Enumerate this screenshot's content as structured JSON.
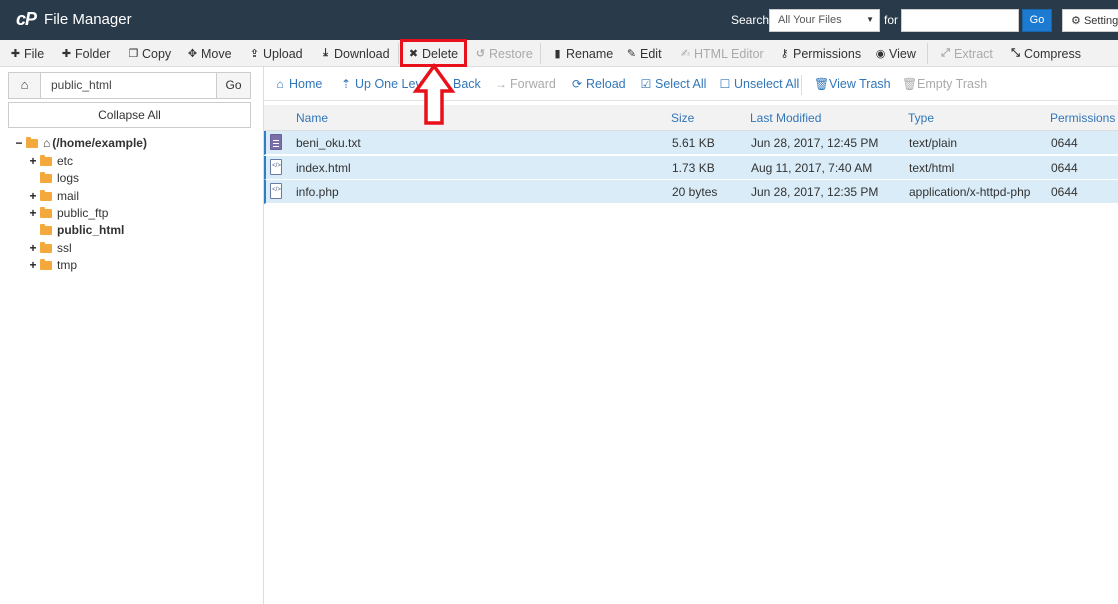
{
  "header": {
    "logo": "cP",
    "title": "File Manager",
    "search_label": "Search",
    "search_scope": "All Your Files",
    "for_label": "for",
    "search_value": "",
    "go_label": "Go",
    "settings_label": "Settings"
  },
  "toolbar": {
    "items": [
      {
        "label": "File",
        "icon": "plus-icon",
        "enabled": true
      },
      {
        "label": "Folder",
        "icon": "plus-icon",
        "enabled": true
      },
      {
        "label": "Copy",
        "icon": "copy-icon",
        "enabled": true
      },
      {
        "label": "Move",
        "icon": "move-icon",
        "enabled": true
      },
      {
        "label": "Upload",
        "icon": "upload-icon",
        "enabled": true
      },
      {
        "label": "Download",
        "icon": "download-icon",
        "enabled": true
      },
      {
        "label": "Delete",
        "icon": "x-icon",
        "enabled": true
      },
      {
        "label": "Restore",
        "icon": "undo-icon",
        "enabled": false
      },
      {
        "label": "Rename",
        "icon": "file-icon",
        "enabled": true
      },
      {
        "label": "Edit",
        "icon": "pencil-icon",
        "enabled": true
      },
      {
        "label": "HTML Editor",
        "icon": "edit-icon",
        "enabled": false
      },
      {
        "label": "Permissions",
        "icon": "key-icon",
        "enabled": true
      },
      {
        "label": "View",
        "icon": "eye-icon",
        "enabled": true
      },
      {
        "label": "Extract",
        "icon": "expand-icon",
        "enabled": false
      },
      {
        "label": "Compress",
        "icon": "compress-icon",
        "enabled": true
      }
    ],
    "highlight_color": "#e8101a"
  },
  "sidebar": {
    "path_value": "public_html",
    "go_label": "Go",
    "collapse_label": "Collapse All",
    "tree": [
      {
        "label": "(/home/example)",
        "toggle": "−",
        "level": 0,
        "bold": true,
        "icon": "home-icon"
      },
      {
        "label": "etc",
        "toggle": "+",
        "level": 1,
        "bold": false
      },
      {
        "label": "logs",
        "toggle": "",
        "level": 1,
        "bold": false
      },
      {
        "label": "mail",
        "toggle": "+",
        "level": 1,
        "bold": false
      },
      {
        "label": "public_ftp",
        "toggle": "+",
        "level": 1,
        "bold": false
      },
      {
        "label": "public_html",
        "toggle": "",
        "level": 1,
        "bold": true
      },
      {
        "label": "ssl",
        "toggle": "+",
        "level": 1,
        "bold": false
      },
      {
        "label": "tmp",
        "toggle": "+",
        "level": 1,
        "bold": false
      }
    ]
  },
  "navbar": {
    "items": [
      {
        "label": "Home",
        "icon": "home-icon",
        "enabled": true
      },
      {
        "label": "Up One Level",
        "icon": "level-up-icon",
        "enabled": true
      },
      {
        "label": "Back",
        "icon": "arrow-left-icon",
        "enabled": true
      },
      {
        "label": "Forward",
        "icon": "arrow-right-icon",
        "enabled": false
      },
      {
        "label": "Reload",
        "icon": "reload-icon",
        "enabled": true
      },
      {
        "label": "Select All",
        "icon": "checkbox-checked-icon",
        "enabled": true
      },
      {
        "label": "Unselect All",
        "icon": "checkbox-empty-icon",
        "enabled": true
      },
      {
        "label": "View Trash",
        "icon": "trash-icon",
        "enabled": true
      },
      {
        "label": "Empty Trash",
        "icon": "trash-icon",
        "enabled": false
      }
    ]
  },
  "table": {
    "columns": [
      "Name",
      "Size",
      "Last Modified",
      "Type",
      "Permissions"
    ],
    "rows": [
      {
        "icon": "text-file-icon",
        "name": "beni_oku.txt",
        "size": "5.61 KB",
        "modified": "Jun 28, 2017, 12:45 PM",
        "type": "text/plain",
        "perms": "0644"
      },
      {
        "icon": "code-file-icon",
        "name": "index.html",
        "size": "1.73 KB",
        "modified": "Aug 11, 2017, 7:40 AM",
        "type": "text/html",
        "perms": "0644"
      },
      {
        "icon": "code-file-icon",
        "name": "info.php",
        "size": "20 bytes",
        "modified": "Jun 28, 2017, 12:35 PM",
        "type": "application/x-httpd-php",
        "perms": "0644"
      }
    ]
  }
}
